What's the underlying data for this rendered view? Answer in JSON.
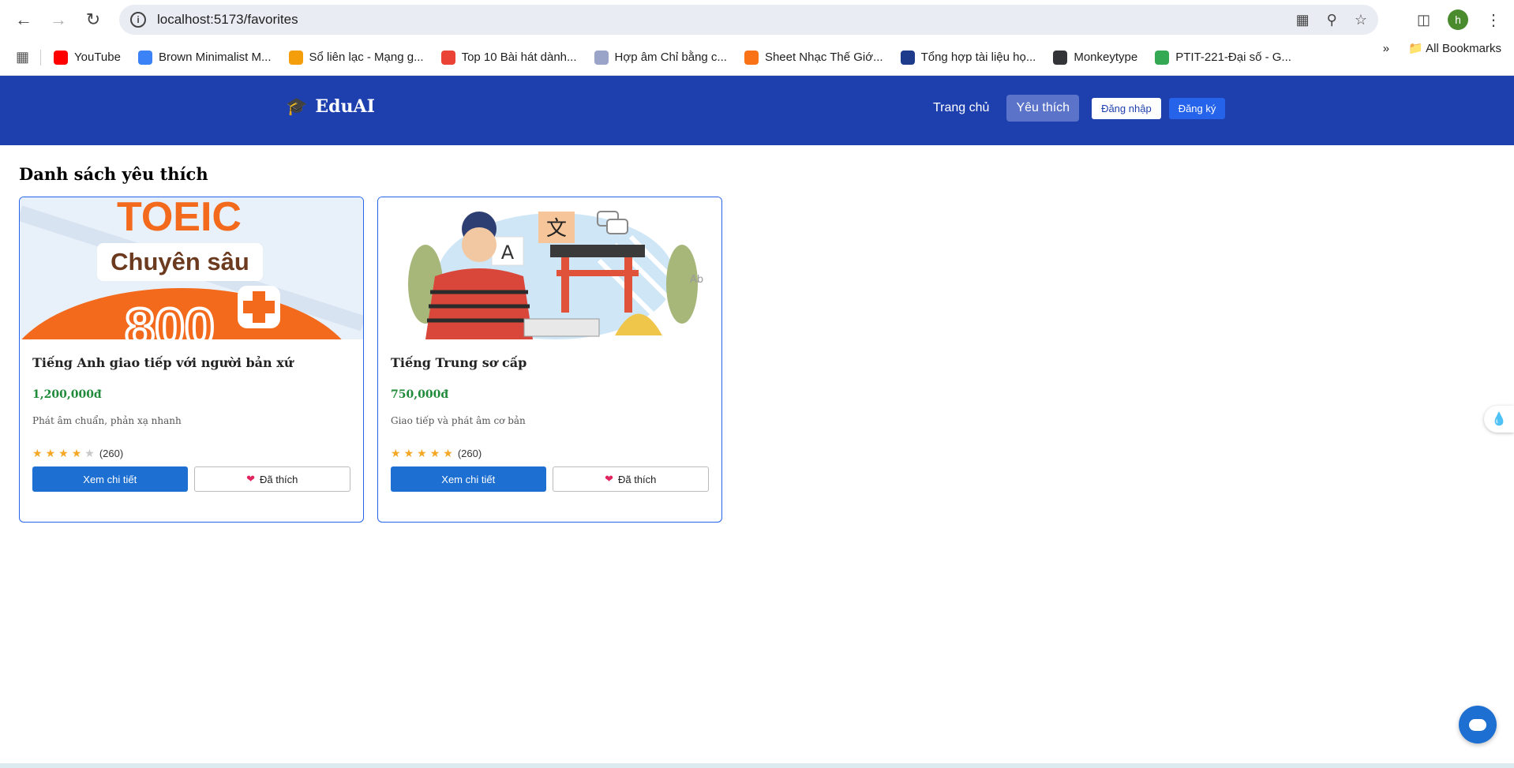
{
  "browser": {
    "url": "localhost:5173/favorites",
    "bookmarks": [
      {
        "label": "YouTube",
        "color": "#ff0000"
      },
      {
        "label": "Brown Minimalist M...",
        "color": "#3b82f6"
      },
      {
        "label": "Sổ liên lạc - Mạng g...",
        "color": "#f59e0b"
      },
      {
        "label": "Top 10 Bài hát dành...",
        "color": "#ea4335"
      },
      {
        "label": "Hợp âm Chỉ bằng c...",
        "color": "#9aa4c8"
      },
      {
        "label": "Sheet Nhạc Thế Giớ...",
        "color": "#f97316"
      },
      {
        "label": "Tổng hợp tài liệu họ...",
        "color": "#1e3a8a"
      },
      {
        "label": "Monkeytype",
        "color": "#323437"
      },
      {
        "label": "PTIT-221-Đại số - G...",
        "color": "#34a853"
      }
    ],
    "all_bookmarks": "All Bookmarks",
    "profile_initial": "h"
  },
  "header": {
    "brand": "EduAI",
    "nav": {
      "home": "Trang chủ",
      "favorites": "Yêu thích",
      "login": "Đăng nhập",
      "register": "Đăng ký"
    }
  },
  "main": {
    "title": "Danh sách yêu thích",
    "courses": [
      {
        "title": "Tiếng Anh giao tiếp với người bản xứ",
        "price": "1,200,000đ",
        "description": "Phát âm chuẩn, phản xạ nhanh",
        "rating": 4,
        "reviews": "(260)",
        "detail_label": "Xem chi tiết",
        "fav_label": "Đã thích",
        "image_text_1": "TOEIC",
        "image_text_2": "Chuyên sâu",
        "image_text_3": "800"
      },
      {
        "title": "Tiếng Trung sơ cấp",
        "price": "750,000đ",
        "description": "Giao tiếp và phát âm cơ bản",
        "rating": 4.5,
        "reviews": "(260)",
        "detail_label": "Xem chi tiết",
        "fav_label": "Đã thích",
        "image_text_1": "文",
        "image_text_2": "A",
        "image_text_3": "Ab"
      }
    ]
  }
}
